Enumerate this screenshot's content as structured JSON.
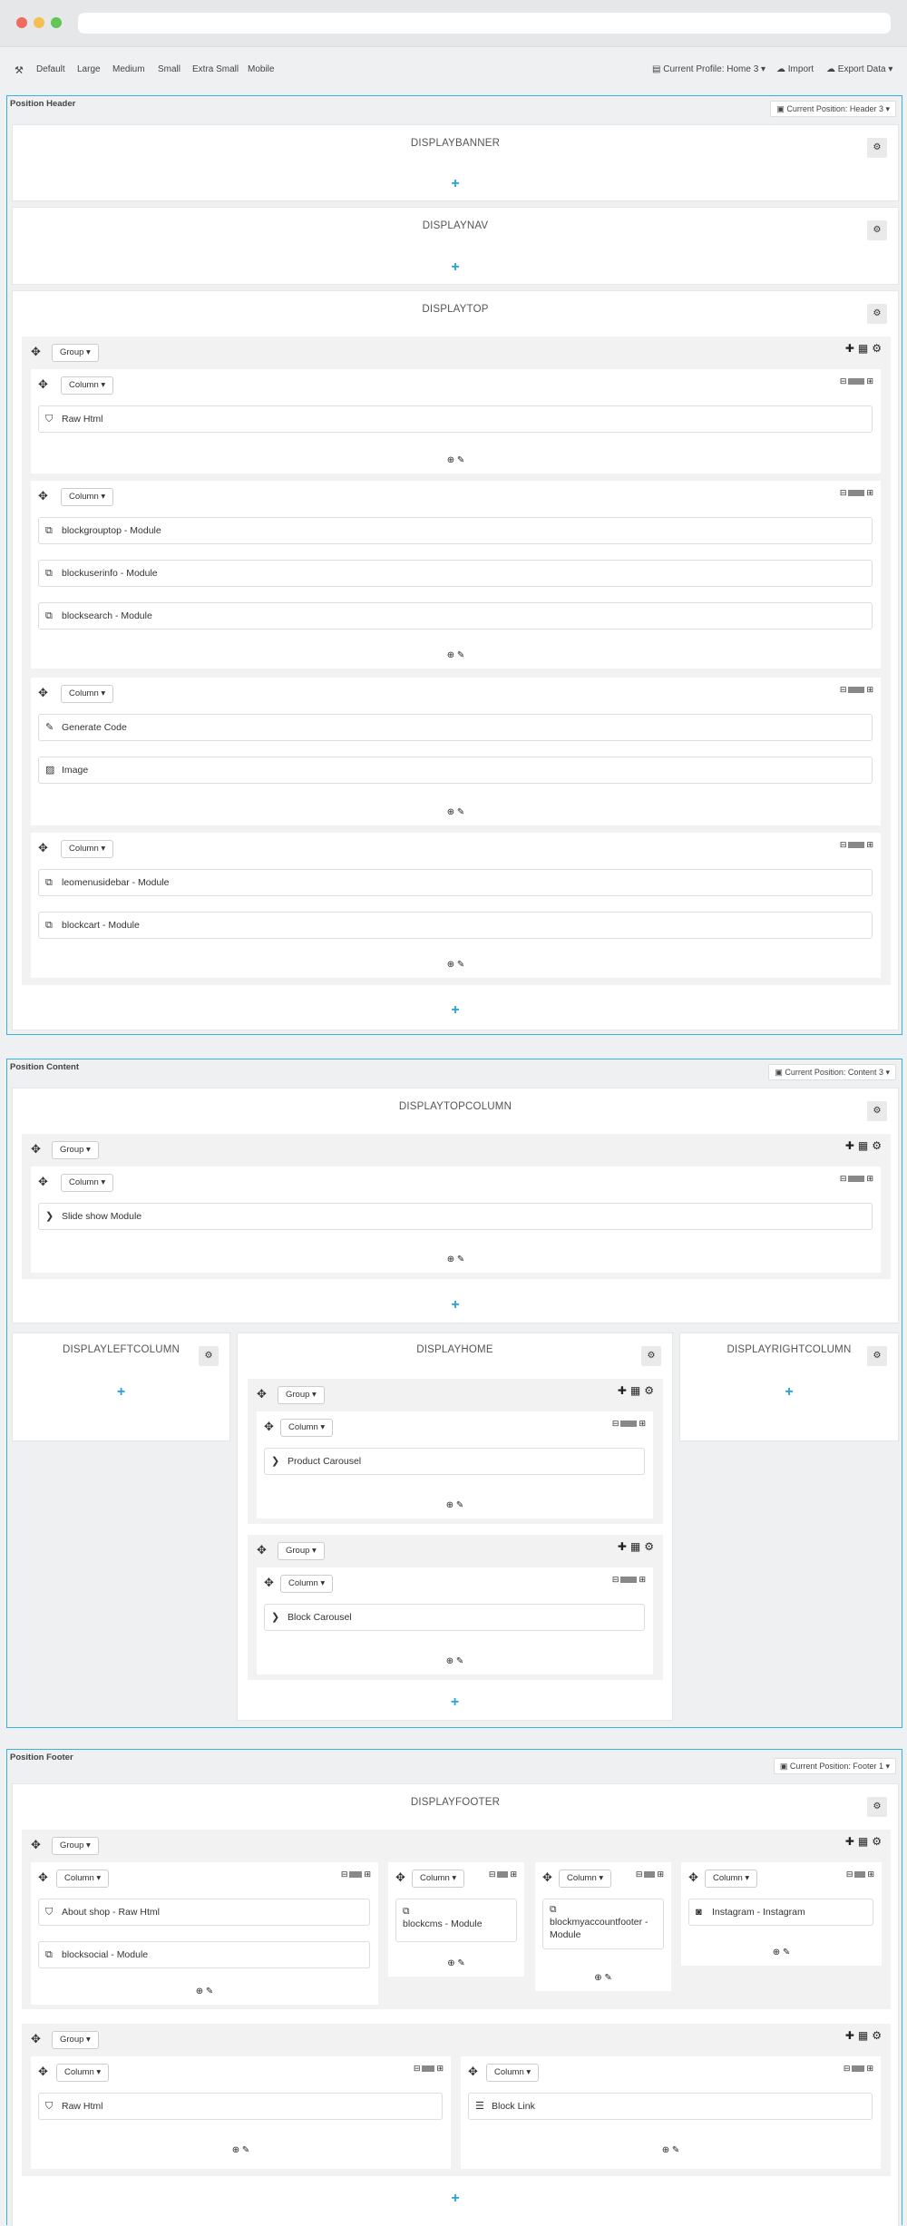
{
  "browser": {
    "colors": {
      "close": "#ed6b5f",
      "minimize": "#f5bf4f",
      "maximize": "#62c655"
    }
  },
  "toolbar": {
    "devices": [
      "Default",
      "Large",
      "Medium",
      "Small",
      "Extra Small",
      "Mobile"
    ],
    "profile": "Current Profile: Home 3",
    "import": "Import",
    "export": "Export Data"
  },
  "icons": {
    "move": "✥",
    "cog": "⚙",
    "plus": "+",
    "grid": "⊞",
    "minus": "⊟",
    "add_col": "⊞",
    "edit": "✎",
    "chevron": "❯",
    "code": "⚡"
  },
  "header": {
    "title": "Position Header",
    "current": "Current Position: Header 3",
    "hooks": {
      "banner": "DISPLAYBANNER",
      "nav": "DISPLAYNAV",
      "top": "DISPLAYTOP"
    },
    "group": "Group",
    "column": "Column",
    "col1": [
      "Raw Html"
    ],
    "col2": [
      "blockgrouptop - Module",
      "blockuserinfo - Module",
      "blocksearch - Module"
    ],
    "col3": [
      "Generate Code",
      "Image"
    ],
    "col4": [
      "leomenusidebar - Module",
      "blockcart - Module"
    ]
  },
  "content": {
    "title": "Position Content",
    "current": "Current Position: Content 3",
    "hooks": {
      "topcolumn": "DISPLAYTOPCOLUMN",
      "left": "DISPLAYLEFTCOLUMN",
      "home": "DISPLAYHOME",
      "right": "DISPLAYRIGHTCOLUMN"
    },
    "group": "Group",
    "column": "Column",
    "slideshow": "Slide show Module",
    "product_carousel": "Product Carousel",
    "block_carousel": "Block Carousel"
  },
  "footer": {
    "title": "Position Footer",
    "current": "Current Position: Footer 1",
    "hook": "DISPLAYFOOTER",
    "group": "Group",
    "column": "Column",
    "g1c1": [
      "About shop - Raw Html",
      "blocksocial - Module"
    ],
    "g1c2": "blockcms - Module",
    "g1c3": "blockmyaccountfooter - Module",
    "g1c4": "Instagram - Instagram",
    "g2c1": "Raw Html",
    "g2c2": "Block Link"
  }
}
